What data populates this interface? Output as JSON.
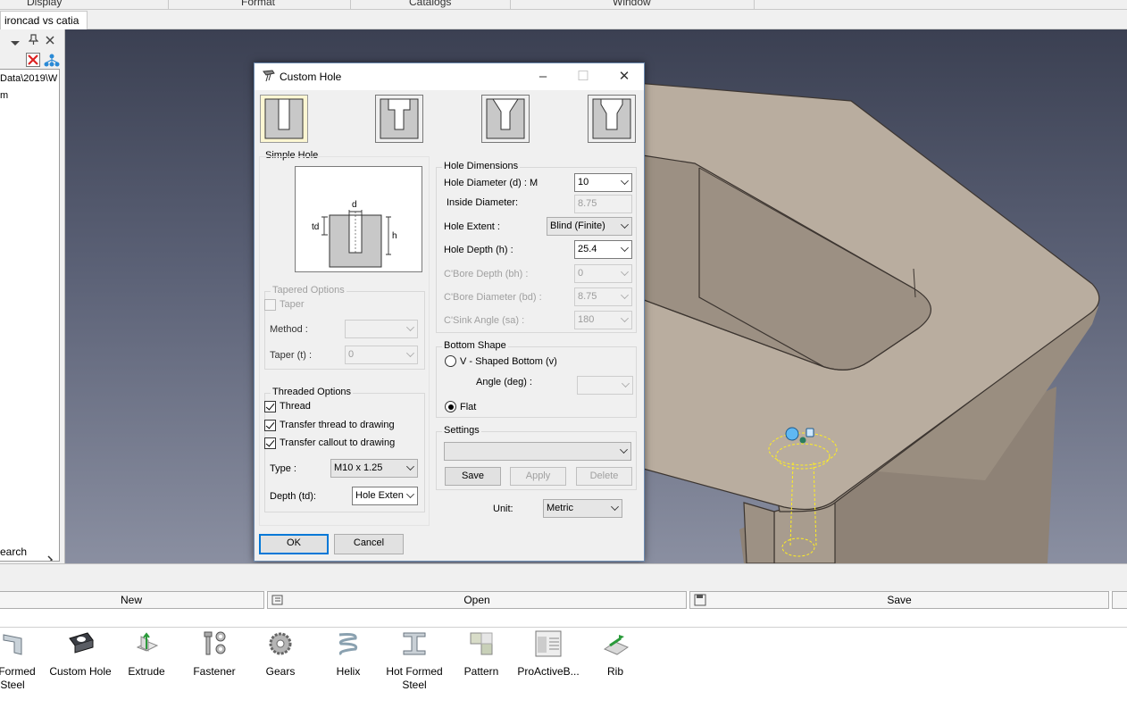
{
  "menubar": {
    "items": [
      "Display",
      "Format",
      "Catalogs",
      "Window"
    ]
  },
  "tabs": {
    "document": "ironcad vs catia"
  },
  "left_panel": {
    "tree_items": [
      "Data\\2019\\W",
      "m"
    ],
    "search_label": "earch"
  },
  "dialog": {
    "title": "Custom Hole",
    "hole_types": [
      "simple-hole",
      "counterbore-hole",
      "countersink-hole",
      "counterdrill-hole"
    ],
    "simple_hole_label": "Simple Hole",
    "diagram_labels": {
      "d": "d",
      "td": "td",
      "h": "h"
    },
    "tapered": {
      "label": "Tapered Options",
      "taper_label": "Taper",
      "method_label": "Method :",
      "method_value": "",
      "taper_t_label": "Taper (t) :",
      "taper_t_value": "0"
    },
    "threaded": {
      "label": "Threaded Options",
      "thread_label": "Thread",
      "transfer_thread_label": "Transfer thread to drawing",
      "transfer_callout_label": "Transfer callout to drawing",
      "type_label": "Type :",
      "type_value": "M10 x 1.25",
      "depth_label": "Depth (td):",
      "depth_value": "Hole Exten"
    },
    "dimensions": {
      "label": "Hole Dimensions",
      "diameter_label": "Hole Diameter (d) : M",
      "diameter_value": "10",
      "inside_diameter_label": "Inside Diameter:",
      "inside_diameter_value": "8.75",
      "extent_label": "Hole Extent :",
      "extent_value": "Blind (Finite)",
      "depth_label": "Hole Depth (h) :",
      "depth_value": "25.4",
      "cbore_depth_label": "C'Bore Depth (bh) :",
      "cbore_depth_value": "0",
      "cbore_diameter_label": "C'Bore Diameter (bd) :",
      "cbore_diameter_value": "8.75",
      "csink_angle_label": "C'Sink Angle (sa) :",
      "csink_angle_value": "180"
    },
    "bottom_shape": {
      "label": "Bottom Shape",
      "v_shaped_label": "V - Shaped Bottom (v)",
      "angle_label": "Angle (deg) :",
      "angle_value": "",
      "flat_label": "Flat"
    },
    "settings": {
      "label": "Settings",
      "value": "",
      "save_label": "Save",
      "apply_label": "Apply",
      "delete_label": "Delete"
    },
    "unit_label": "Unit:",
    "unit_value": "Metric",
    "ok_label": "OK",
    "cancel_label": "Cancel"
  },
  "bottom_bar": {
    "new_label": "New",
    "open_label": "Open",
    "save_label": "Save"
  },
  "catalog": {
    "items": [
      {
        "label": "d Formed\nSteel",
        "icon": "cold-formed-steel-icon"
      },
      {
        "label": "Custom Hole",
        "icon": "custom-hole-icon"
      },
      {
        "label": "Extrude",
        "icon": "extrude-icon"
      },
      {
        "label": "Fastener",
        "icon": "fastener-icon"
      },
      {
        "label": "Gears",
        "icon": "gears-icon"
      },
      {
        "label": "Helix",
        "icon": "helix-icon"
      },
      {
        "label": "Hot Formed\nSteel",
        "icon": "hot-formed-steel-icon"
      },
      {
        "label": "Pattern",
        "icon": "pattern-icon"
      },
      {
        "label": "ProActiveB...",
        "icon": "proactive-icon"
      },
      {
        "label": "Rib",
        "icon": "rib-icon"
      }
    ]
  },
  "colors": {
    "viewport_top": "#3b4052",
    "model_face": "#b9ad9f",
    "accent": "#0078d7"
  }
}
